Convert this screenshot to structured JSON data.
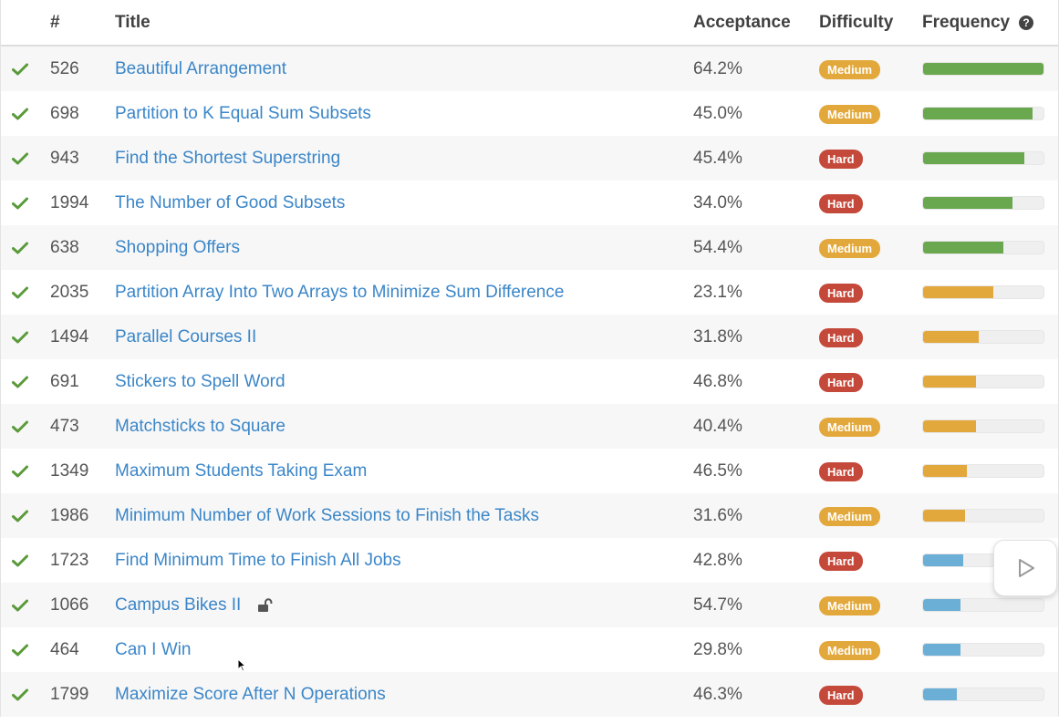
{
  "header": {
    "num": "#",
    "title": "Title",
    "acceptance": "Acceptance",
    "difficulty": "Difficulty",
    "frequency": "Frequency"
  },
  "colors": {
    "link": "#3b86c8",
    "check": "#5a9a3a",
    "medium": "#e3a83b",
    "hard": "#c5493a",
    "freq_green": "#6aa84f",
    "freq_orange": "#e3a83b",
    "freq_blue": "#6baed6"
  },
  "icons": {
    "status": "check-icon",
    "help": "question-circle-icon",
    "premium": "unlock-icon",
    "video": "play-icon"
  },
  "rows": [
    {
      "num": "526",
      "title": "Beautiful Arrangement",
      "acceptance": "64.2%",
      "difficulty": "Medium",
      "frequency": 1.0,
      "freq_color": "green"
    },
    {
      "num": "698",
      "title": "Partition to K Equal Sum Subsets",
      "acceptance": "45.0%",
      "difficulty": "Medium",
      "frequency": 0.91,
      "freq_color": "green"
    },
    {
      "num": "943",
      "title": "Find the Shortest Superstring",
      "acceptance": "45.4%",
      "difficulty": "Hard",
      "frequency": 0.84,
      "freq_color": "green"
    },
    {
      "num": "1994",
      "title": "The Number of Good Subsets",
      "acceptance": "34.0%",
      "difficulty": "Hard",
      "frequency": 0.74,
      "freq_color": "green"
    },
    {
      "num": "638",
      "title": "Shopping Offers",
      "acceptance": "54.4%",
      "difficulty": "Medium",
      "frequency": 0.67,
      "freq_color": "green"
    },
    {
      "num": "2035",
      "title": "Partition Array Into Two Arrays to Minimize Sum Difference",
      "acceptance": "23.1%",
      "difficulty": "Hard",
      "frequency": 0.58,
      "freq_color": "orange"
    },
    {
      "num": "1494",
      "title": "Parallel Courses II",
      "acceptance": "31.8%",
      "difficulty": "Hard",
      "frequency": 0.46,
      "freq_color": "orange"
    },
    {
      "num": "691",
      "title": "Stickers to Spell Word",
      "acceptance": "46.8%",
      "difficulty": "Hard",
      "frequency": 0.44,
      "freq_color": "orange"
    },
    {
      "num": "473",
      "title": "Matchsticks to Square",
      "acceptance": "40.4%",
      "difficulty": "Medium",
      "frequency": 0.44,
      "freq_color": "orange"
    },
    {
      "num": "1349",
      "title": "Maximum Students Taking Exam",
      "acceptance": "46.5%",
      "difficulty": "Hard",
      "frequency": 0.36,
      "freq_color": "orange"
    },
    {
      "num": "1986",
      "title": "Minimum Number of Work Sessions to Finish the Tasks",
      "acceptance": "31.6%",
      "difficulty": "Medium",
      "frequency": 0.35,
      "freq_color": "orange"
    },
    {
      "num": "1723",
      "title": "Find Minimum Time to Finish All Jobs",
      "acceptance": "42.8%",
      "difficulty": "Hard",
      "frequency": 0.33,
      "freq_color": "blue"
    },
    {
      "num": "1066",
      "title": "Campus Bikes II",
      "acceptance": "54.7%",
      "difficulty": "Medium",
      "frequency": 0.31,
      "freq_color": "blue",
      "premium": true
    },
    {
      "num": "464",
      "title": "Can I Win",
      "acceptance": "29.8%",
      "difficulty": "Medium",
      "frequency": 0.31,
      "freq_color": "blue"
    },
    {
      "num": "1799",
      "title": "Maximize Score After N Operations",
      "acceptance": "46.3%",
      "difficulty": "Hard",
      "frequency": 0.28,
      "freq_color": "blue"
    }
  ]
}
